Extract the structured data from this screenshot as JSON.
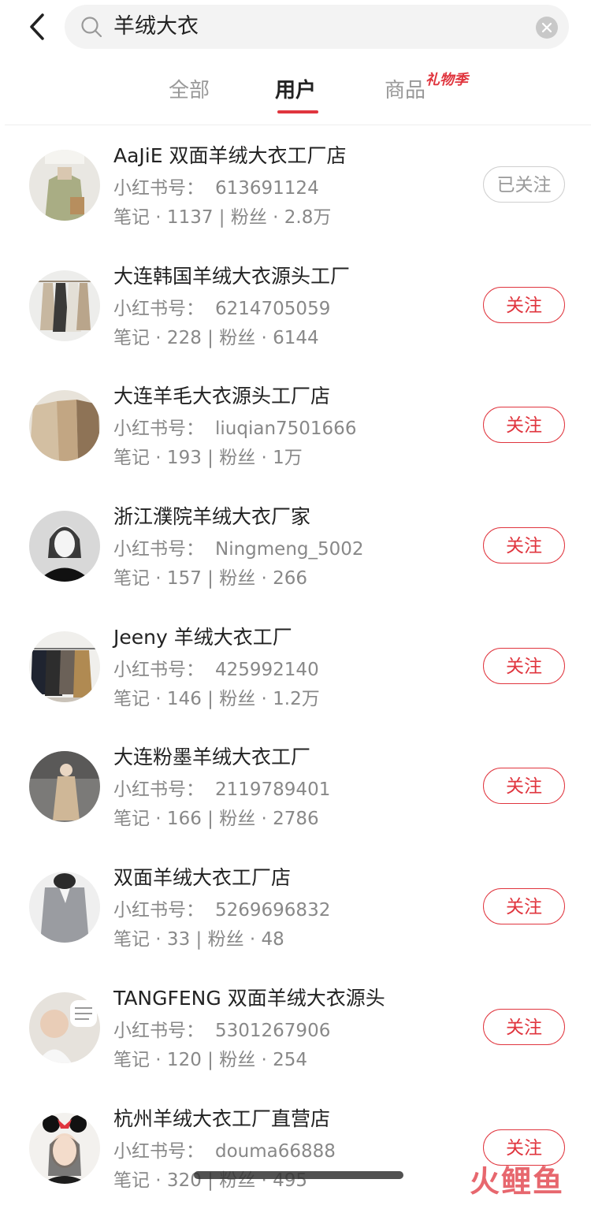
{
  "search": {
    "query": "羊绒大衣"
  },
  "tabs": [
    {
      "label": "全部"
    },
    {
      "label": "用户"
    },
    {
      "label": "商品"
    }
  ],
  "badge": {
    "label": "礼物季"
  },
  "rid_label": "小红书号：",
  "users": [
    {
      "name": "AaJiE 双面羊绒大衣工厂店",
      "rid": "613691124",
      "stats": "笔记 · 1137 | 粉丝 · 2.8万",
      "button": "已关注"
    },
    {
      "name": "大连韩国羊绒大衣源头工厂",
      "rid": "6214705059",
      "stats": "笔记 · 228 | 粉丝 · 6144",
      "button": "关注"
    },
    {
      "name": "大连羊毛大衣源头工厂店",
      "rid": "liuqian7501666",
      "stats": "笔记 · 193 | 粉丝 · 1万",
      "button": "关注"
    },
    {
      "name": "浙江濮院羊绒大衣厂家",
      "rid": "Ningmeng_5002",
      "stats": "笔记 · 157 | 粉丝 · 266",
      "button": "关注"
    },
    {
      "name": "Jeeny 羊绒大衣工厂",
      "rid": "425992140",
      "stats": "笔记 · 146 | 粉丝 · 1.2万",
      "button": "关注"
    },
    {
      "name": "大连粉墨羊绒大衣工厂",
      "rid": "2119789401",
      "stats": "笔记 · 166 | 粉丝 · 2786",
      "button": "关注"
    },
    {
      "name": "双面羊绒大衣工厂店",
      "rid": "5269696832",
      "stats": "笔记 · 33 | 粉丝 · 48",
      "button": "关注"
    },
    {
      "name": "TANGFENG 双面羊绒大衣源头",
      "rid": "5301267906",
      "stats": "笔记 · 120 | 粉丝 · 254",
      "button": "关注"
    },
    {
      "name": "杭州羊绒大衣工厂直营店",
      "rid": "douma66888",
      "stats": "笔记 · 320 | 粉丝 · 495",
      "button": "关注"
    }
  ],
  "watermark": "火鲤鱼",
  "colors": {
    "accent": "#e0353e",
    "muted": "#888888"
  }
}
